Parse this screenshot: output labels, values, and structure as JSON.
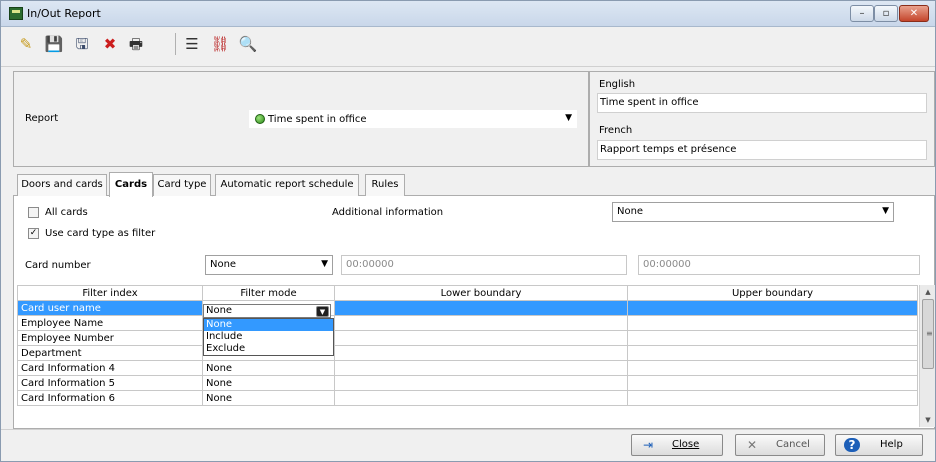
{
  "window": {
    "title": "In/Out Report",
    "minimize_glyph": "–",
    "maximize_glyph": "▫",
    "close_glyph": "✕"
  },
  "toolbar": {
    "icons": [
      "new-icon",
      "save-icon",
      "save-as-icon",
      "delete-icon",
      "print-icon",
      "list-icon",
      "link-icon",
      "search-icon"
    ],
    "glyphs": {
      "new": "✎",
      "save": "💾",
      "save_as": "🖫",
      "delete": "✖",
      "print": "🖶",
      "list": "☰",
      "link": "⛓",
      "search": "🔍"
    }
  },
  "report": {
    "label": "Report",
    "selected": "Time spent in office",
    "arrow": "▼"
  },
  "languages": {
    "english_label": "English",
    "english_value": "Time spent in office",
    "french_label": "French",
    "french_value": "Rapport temps et présence"
  },
  "tabs": [
    {
      "label": "Doors and cards",
      "active": false
    },
    {
      "label": "Cards",
      "active": true
    },
    {
      "label": "Card type",
      "active": false
    },
    {
      "label": "Automatic report schedule",
      "active": false
    },
    {
      "label": "Rules",
      "active": false
    }
  ],
  "cards_tab": {
    "all_cards_label": "All cards",
    "all_cards_checked": false,
    "use_card_type_label": "Use card type as filter",
    "use_card_type_checked": true,
    "check_glyph": "✓",
    "additional_info_label": "Additional information",
    "additional_info_value": "None",
    "card_number_label": "Card number",
    "card_number_mode": "None",
    "card_number_from": "00:00000",
    "card_number_to": "00:00000",
    "arrow": "▼"
  },
  "grid": {
    "columns": [
      "Filter index",
      "Filter mode",
      "Lower boundary",
      "Upper boundary"
    ],
    "rows": [
      {
        "index": "Card user name",
        "mode": "None",
        "lower": "",
        "upper": ""
      },
      {
        "index": "Employee Name",
        "mode": "",
        "lower": "",
        "upper": ""
      },
      {
        "index": "Employee Number",
        "mode": "",
        "lower": "",
        "upper": ""
      },
      {
        "index": "Department",
        "mode": "None",
        "lower": "",
        "upper": ""
      },
      {
        "index": "Card Information 4",
        "mode": "None",
        "lower": "",
        "upper": ""
      },
      {
        "index": "Card Information 5",
        "mode": "None",
        "lower": "",
        "upper": ""
      },
      {
        "index": "Card Information 6",
        "mode": "None",
        "lower": "",
        "upper": ""
      }
    ],
    "editor_value": "None",
    "editor_arrow": "▼",
    "dropdown_options": [
      "None",
      "Include",
      "Exclude"
    ],
    "dropdown_highlighted": "None",
    "scroll_up": "▲",
    "scroll_down": "▼",
    "scroll_grip": "≡"
  },
  "buttons": {
    "close": "Close",
    "cancel": "Cancel",
    "help": "Help",
    "close_glyph": "⇥",
    "cancel_glyph": "✕",
    "help_glyph": "?"
  }
}
